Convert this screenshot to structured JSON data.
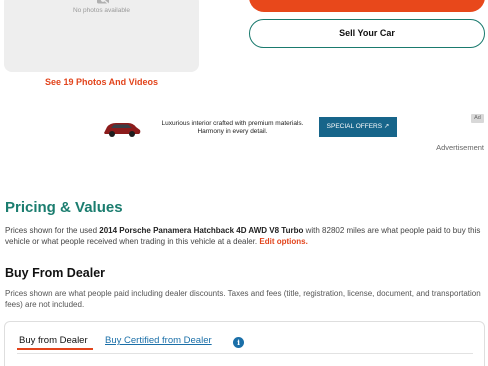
{
  "gallery": {
    "no_photos_text": "No photos available",
    "photos_link": "See 19 Photos And Videos"
  },
  "actions": {
    "top_button_label": "",
    "sell_button_label": "Sell Your Car"
  },
  "ad": {
    "text": "Luxurious interior crafted with premium materials. Harmony in every detail.",
    "button_label": "SPECIAL OFFERS ↗",
    "badge": "Ad",
    "caption": "Advertisement"
  },
  "pricing": {
    "title": "Pricing & Values",
    "desc_prefix": "Prices shown for the used",
    "vehicle": "2014 Porsche Panamera Hatchback 4D AWD V8 Turbo",
    "desc_suffix": "with 82802 miles are what people paid to buy this vehicle or what people received when trading in this vehicle at a dealer.",
    "edit_link": "Edit options."
  },
  "dealer": {
    "title": "Buy From Dealer",
    "desc": "Prices shown are what people paid including dealer discounts. Taxes and fees (title, registration, license, document, and transportation fees) are not included."
  },
  "tabs": [
    {
      "label": "Buy from Dealer"
    },
    {
      "label": "Buy Certified from Dealer"
    }
  ],
  "colors": {
    "accent_orange": "#e8481b",
    "brand_teal": "#1b7d6f",
    "link_blue": "#1a6fa8",
    "ad_button": "#17658a"
  },
  "icons": {
    "no_photo": "camera-slash-icon",
    "info": "info-icon",
    "external_link": "external-link-icon"
  }
}
